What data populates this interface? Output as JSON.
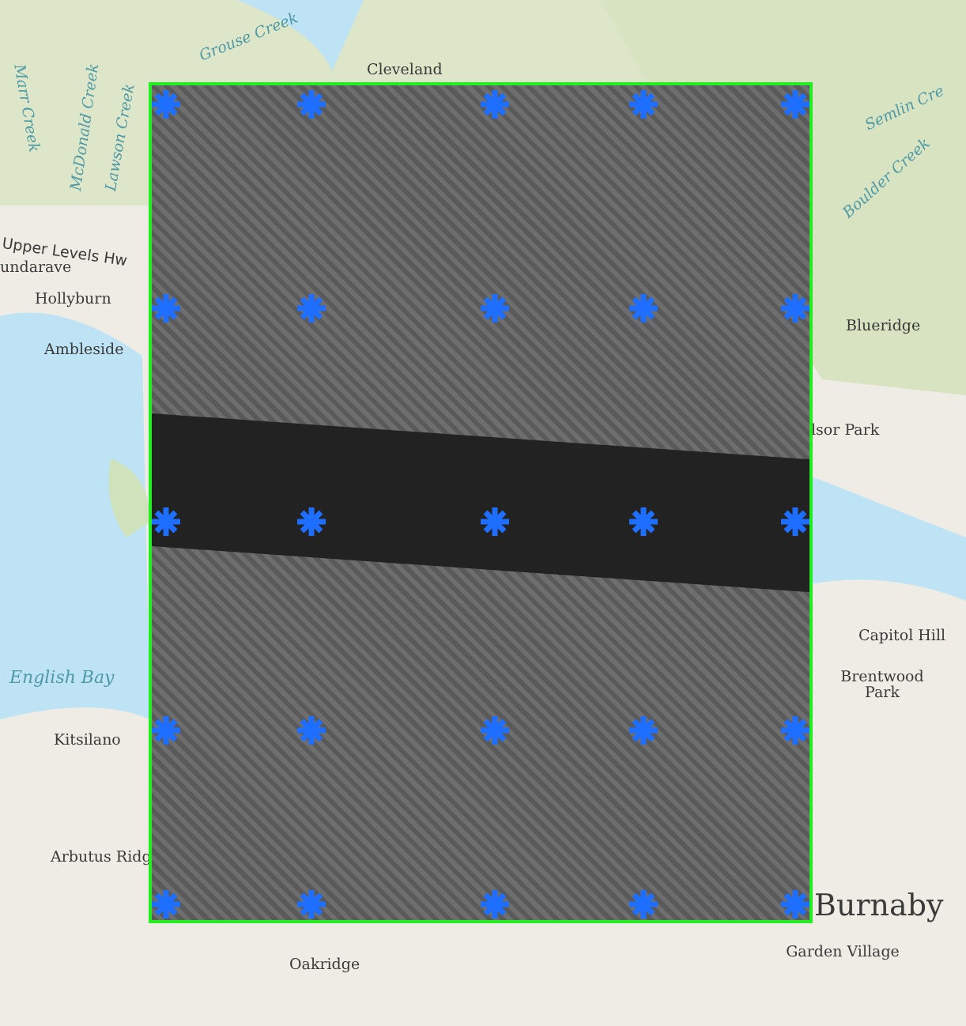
{
  "map": {
    "labels": [
      {
        "text": "Cleveland",
        "kind": "place"
      },
      {
        "text": "Grouse Creek",
        "kind": "creek"
      },
      {
        "text": "Marr Creek",
        "kind": "creek"
      },
      {
        "text": "McDonald Creek",
        "kind": "creek"
      },
      {
        "text": "Lawson Creek",
        "kind": "creek"
      },
      {
        "text": "Upper Levels Hw",
        "kind": "road"
      },
      {
        "text": "undarave",
        "kind": "place"
      },
      {
        "text": "Hollyburn",
        "kind": "place"
      },
      {
        "text": "Ambleside",
        "kind": "place"
      },
      {
        "text": "English Bay",
        "kind": "water"
      },
      {
        "text": "Kitsilano",
        "kind": "place"
      },
      {
        "text": "Arbutus Ridg",
        "kind": "place"
      },
      {
        "text": "Oakridge",
        "kind": "place"
      },
      {
        "text": "Semlin Cre",
        "kind": "creek"
      },
      {
        "text": "Boulder Creek",
        "kind": "creek"
      },
      {
        "text": "Blueridge",
        "kind": "place"
      },
      {
        "text": "lsor Park",
        "kind": "place"
      },
      {
        "text": "Capitol Hill",
        "kind": "place"
      },
      {
        "text": "Brentwood Park",
        "kind": "place"
      },
      {
        "text": "Burnaby",
        "kind": "city"
      },
      {
        "text": "Garden Village",
        "kind": "place"
      }
    ]
  }
}
